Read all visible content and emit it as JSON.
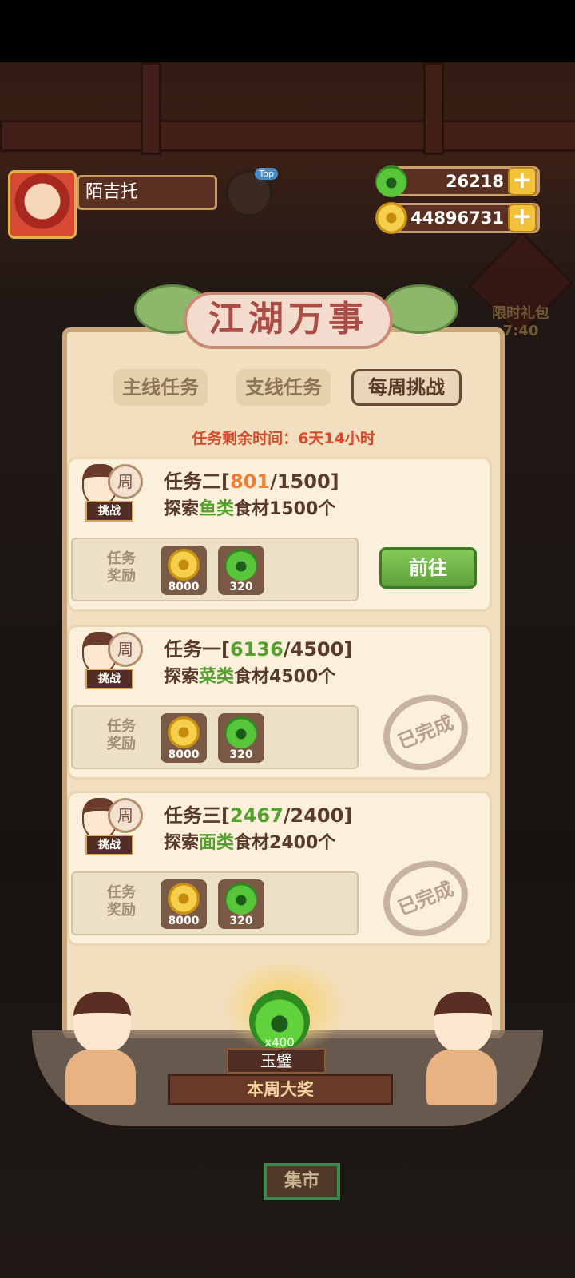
{
  "header": {
    "username": "陌吉托",
    "top_badge_label": "Top",
    "jade_amount": "26218",
    "coin_amount": "44896731",
    "plus_label": "+"
  },
  "promo": {
    "label": "限时礼包",
    "countdown": "7:40"
  },
  "panel": {
    "title": "江湖万事",
    "tabs": [
      "主线任务",
      "支线任务",
      "每周挑战"
    ],
    "active_tab": "每周挑战",
    "timer_label": "任务剩余时间：",
    "timer_value": "6天14小时"
  },
  "tasks": [
    {
      "badge": "周",
      "tag": "挑战",
      "title_prefix": "任务二[",
      "progress": "801",
      "target": "/1500]",
      "desc_prefix": "探索",
      "desc_highlight": "鱼类",
      "desc_suffix": "食材1500个",
      "reward_label": "任务奖励",
      "reward_coin": "8000",
      "reward_jade": "320",
      "action": "前往",
      "status": "in_progress"
    },
    {
      "badge": "周",
      "tag": "挑战",
      "title_prefix": "任务一[",
      "progress": "6136",
      "target": "/4500]",
      "desc_prefix": "探索",
      "desc_highlight": "菜类",
      "desc_suffix": "食材4500个",
      "reward_label": "任务奖励",
      "reward_coin": "8000",
      "reward_jade": "320",
      "stamp": "已完成",
      "status": "completed"
    },
    {
      "badge": "周",
      "tag": "挑战",
      "title_prefix": "任务三[",
      "progress": "2467",
      "target": "/2400]",
      "desc_prefix": "探索",
      "desc_highlight": "面类",
      "desc_suffix": "食材2400个",
      "reward_label": "任务奖励",
      "reward_coin": "8000",
      "reward_jade": "320",
      "stamp": "已完成",
      "status": "completed"
    }
  ],
  "grand_prize": {
    "quantity": "x400",
    "item": "玉璧",
    "caption": "本周大奖"
  },
  "market": {
    "label": "集市"
  },
  "colors": {
    "panel_bg": "#f2dfbf",
    "accent_red": "#d84a2b",
    "progress_orange": "#e8803a",
    "progress_green": "#56a02f",
    "go_button": "#5da23a"
  }
}
